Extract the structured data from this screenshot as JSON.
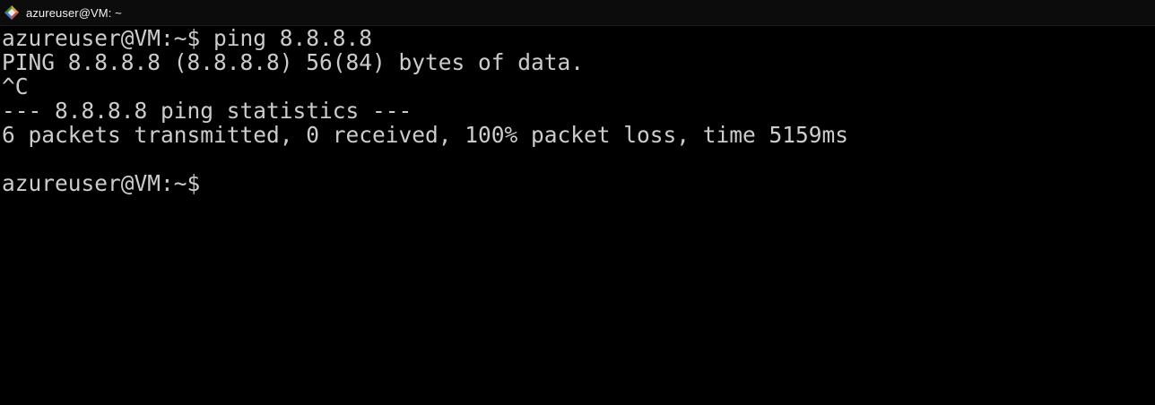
{
  "window": {
    "title": "azureuser@VM: ~",
    "icon": "putty-icon"
  },
  "terminal": {
    "lines": [
      "azureuser@VM:~$ ping 8.8.8.8",
      "PING 8.8.8.8 (8.8.8.8) 56(84) bytes of data.",
      "^C",
      "--- 8.8.8.8 ping statistics ---",
      "6 packets transmitted, 0 received, 100% packet loss, time 5159ms",
      "",
      "azureuser@VM:~$"
    ],
    "foreground": "#cccccc",
    "background": "#000000"
  }
}
